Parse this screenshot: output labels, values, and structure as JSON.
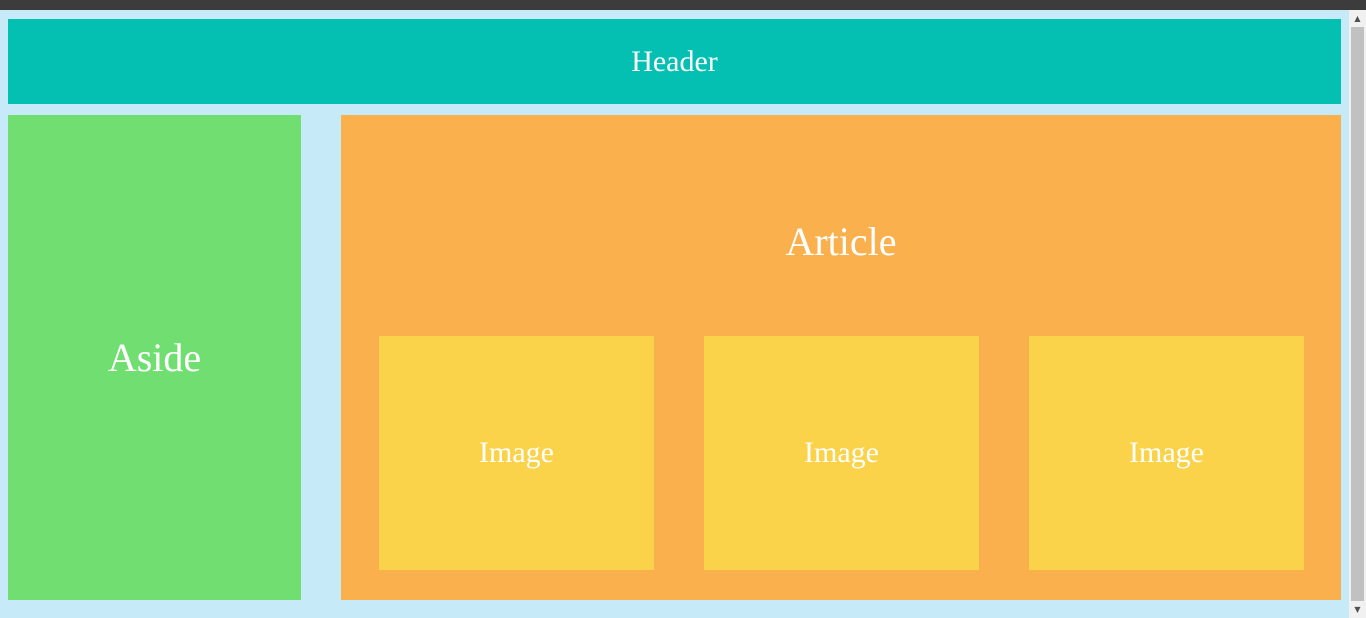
{
  "header": {
    "label": "Header"
  },
  "aside": {
    "label": "Aside"
  },
  "article": {
    "title": "Article",
    "images": [
      {
        "label": "Image"
      },
      {
        "label": "Image"
      },
      {
        "label": "Image"
      }
    ]
  },
  "colors": {
    "page_background": "#c6eaf7",
    "header": "#04c0b3",
    "aside": "#70de70",
    "article": "#fbb04e",
    "image": "#fbd34a",
    "text": "#ffffff"
  },
  "scrollbar": {
    "up_icon": "triangle-up-icon",
    "down_icon": "triangle-down-icon"
  }
}
